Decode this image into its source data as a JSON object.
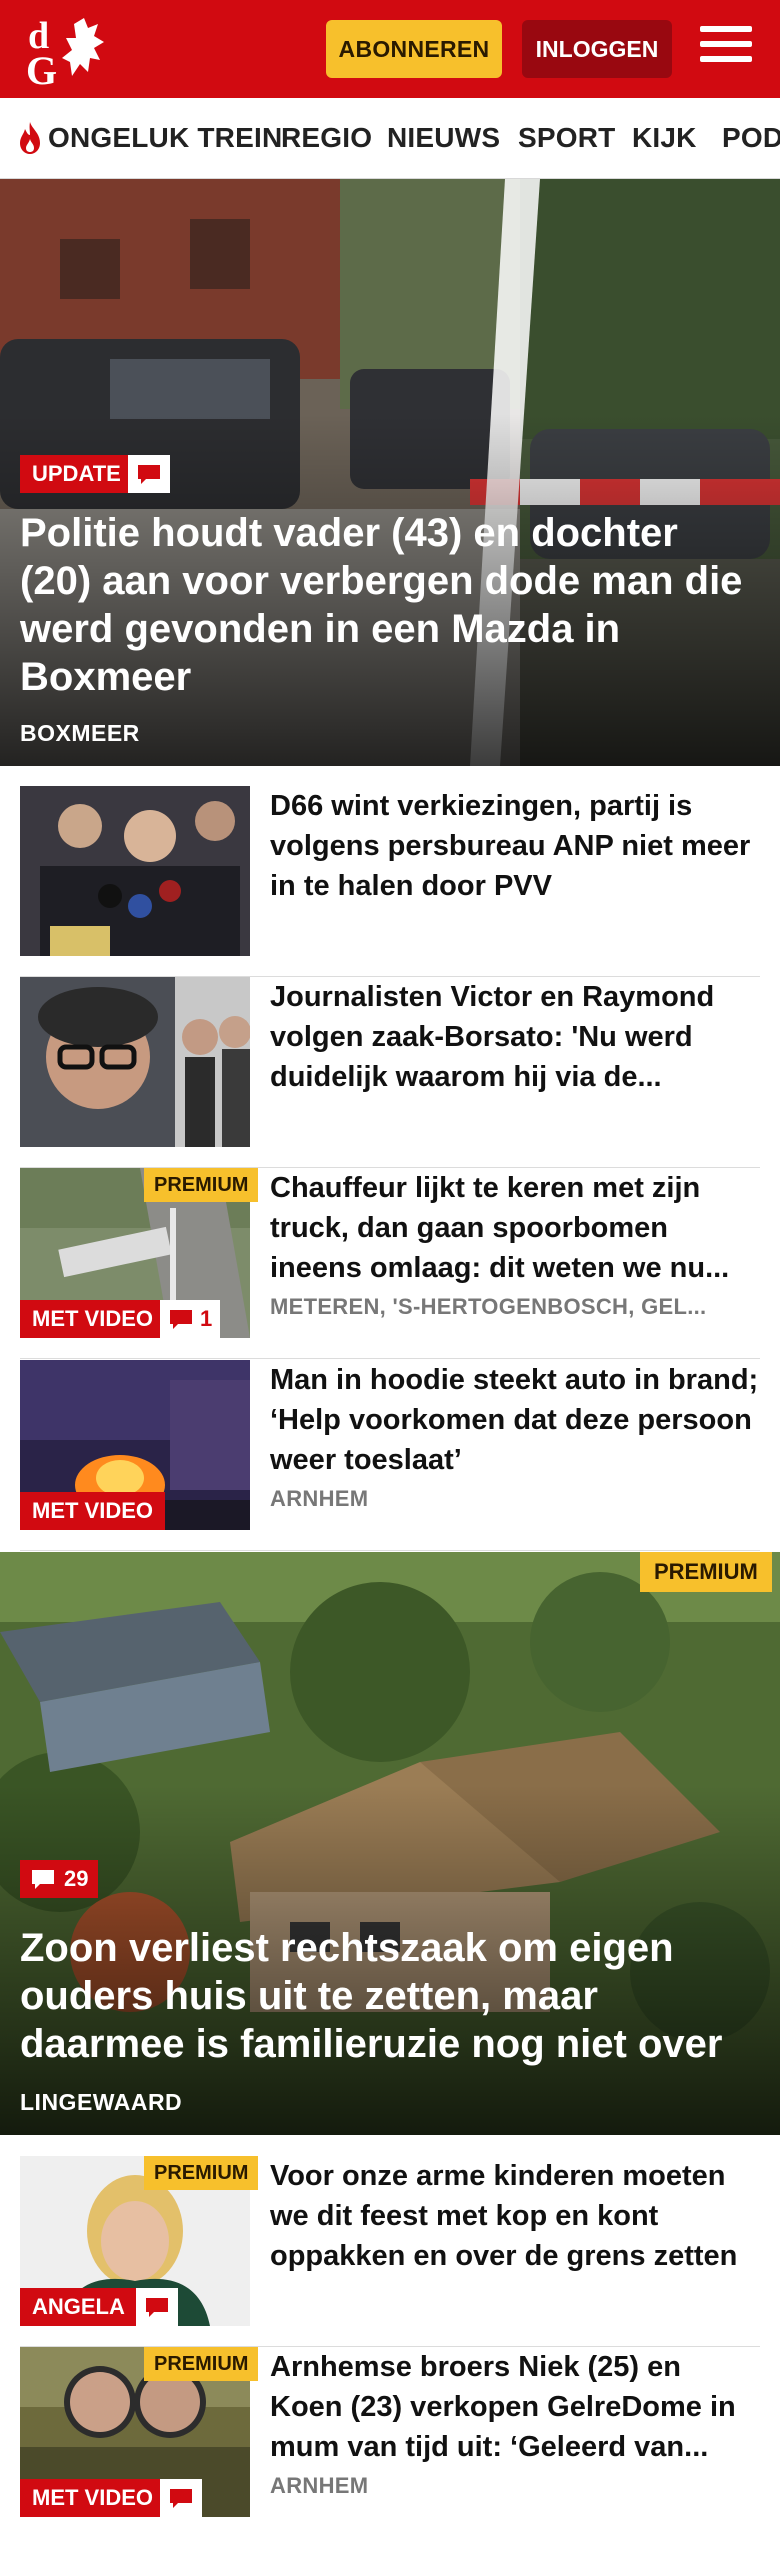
{
  "header": {
    "logo_text": "dG",
    "subscribe_label": "ABONNEREN",
    "login_label": "INLOGGEN"
  },
  "nav": {
    "items": [
      "ONGELUK TREIN",
      "REGIO",
      "NIEUWS",
      "SPORT",
      "KIJK",
      "POD"
    ]
  },
  "hero1": {
    "tag": "UPDATE",
    "title": "Politie houdt vader (43) en dochter (20) aan voor verbergen dode man die werd gevonden in een Mazda in Boxmeer",
    "location": "BOXMEER"
  },
  "articles1": [
    {
      "title": "D66 wint verkiezingen, partij is volgens persbureau ANP niet meer in te halen door PVV",
      "location": ""
    },
    {
      "title": "Journalisten Victor en Raymond volgen zaak-Borsato: 'Nu werd duidelijk waarom hij via de...",
      "location": ""
    },
    {
      "premium": "PREMIUM",
      "tag": "MET VIDEO",
      "comments": "1",
      "title": "Chauffeur lijkt te keren met zijn truck, dan gaan spoorbomen ineens omlaag: dit weten we nu...",
      "location": "METEREN, 'S-HERTOGENBOSCH, GEL..."
    },
    {
      "tag": "MET VIDEO",
      "title": "Man in hoodie steekt auto in brand; ‘Help voorkomen dat deze persoon weer toeslaat’",
      "location": "ARNHEM"
    }
  ],
  "hero2": {
    "premium": "PREMIUM",
    "comments": "29",
    "title": "Zoon verliest rechtszaak om eigen ouders huis uit te zetten, maar daarmee is familieruzie nog niet over",
    "location": "LINGEWAARD"
  },
  "articles2": [
    {
      "premium": "PREMIUM",
      "tag": "ANGELA",
      "title": "Voor onze arme kinderen moeten we dit feest met kop en kont oppakken en over de grens zetten",
      "location": ""
    },
    {
      "premium": "PREMIUM",
      "tag": "MET VIDEO",
      "title": "Arnhemse broers Niek (25) en Koen (23) verkopen GelreDome in mum van tijd uit: ‘Geleerd van...",
      "location": "ARNHEM"
    }
  ],
  "colors": {
    "brand_red": "#d10a11",
    "premium_yellow": "#f7c02c",
    "login_dark_red": "#990810"
  }
}
